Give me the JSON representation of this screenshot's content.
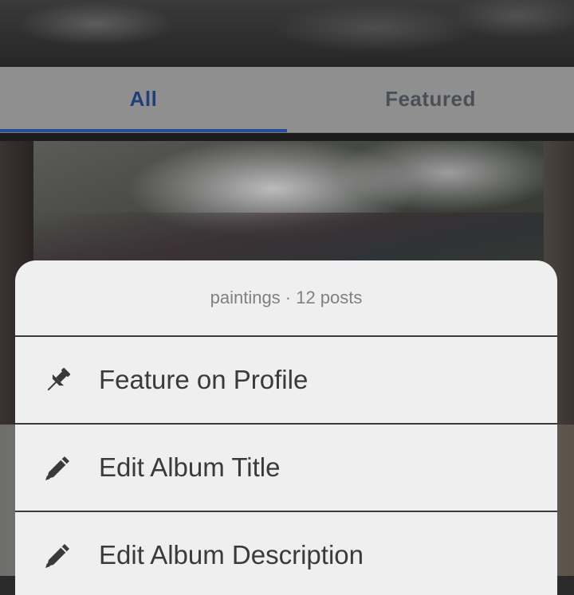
{
  "tabs": {
    "all": "All",
    "featured": "Featured"
  },
  "action_sheet": {
    "header": "paintings · 12 posts",
    "items": [
      {
        "label": "Feature on Profile",
        "icon": "pin-icon"
      },
      {
        "label": "Edit Album Title",
        "icon": "pencil-icon"
      },
      {
        "label": "Edit Album Description",
        "icon": "pencil-icon"
      }
    ]
  },
  "colors": {
    "accent": "#254d99",
    "sheet_background": "#efefef"
  }
}
